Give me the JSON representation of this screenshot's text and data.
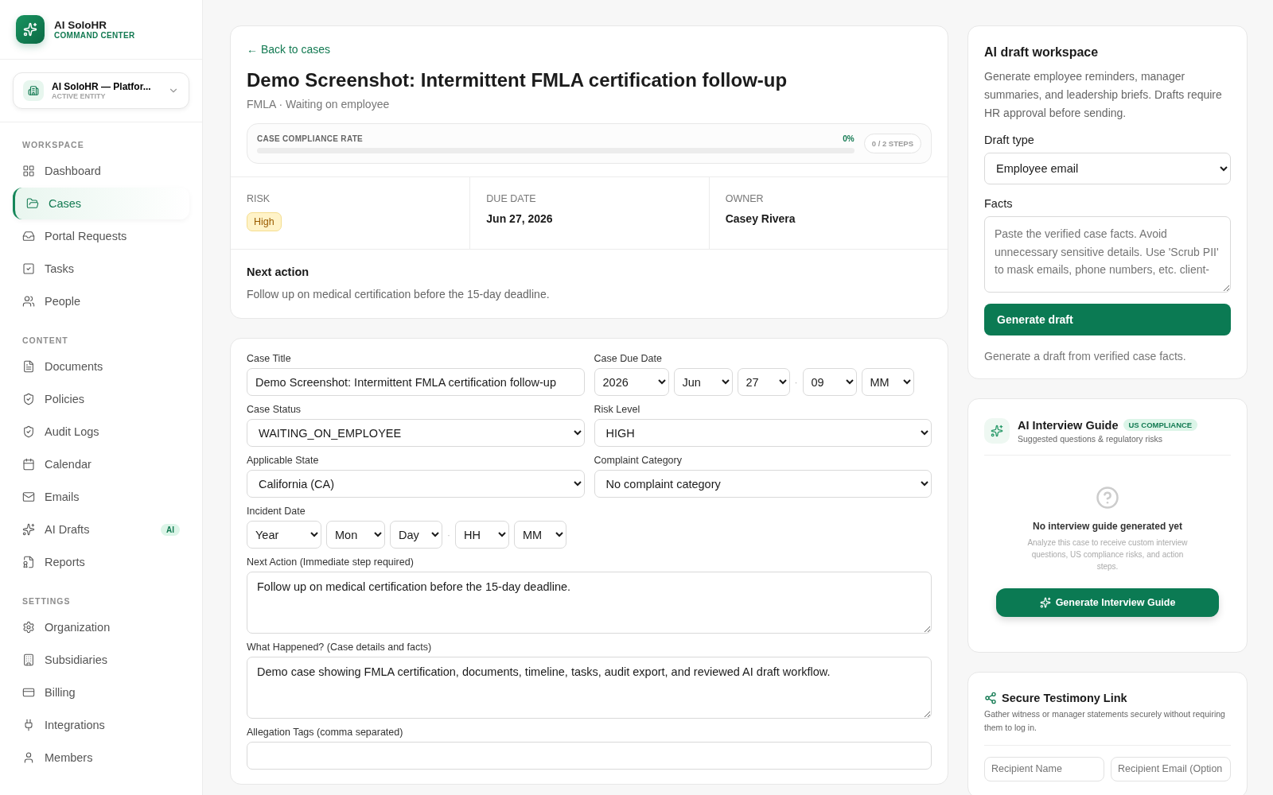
{
  "sidebar": {
    "brand": {
      "name": "AI SoloHR",
      "subtitle": "COMMAND CENTER"
    },
    "entity": {
      "name": "AI SoloHR — Platfor...",
      "caption": "ACTIVE ENTITY"
    },
    "sections": [
      {
        "heading": "WORKSPACE",
        "items": [
          {
            "label": "Dashboard",
            "selected": false
          },
          {
            "label": "Cases",
            "selected": true
          },
          {
            "label": "Portal Requests",
            "selected": false
          },
          {
            "label": "Tasks",
            "selected": false
          },
          {
            "label": "People",
            "selected": false
          }
        ]
      },
      {
        "heading": "CONTENT",
        "items": [
          {
            "label": "Documents",
            "selected": false
          },
          {
            "label": "Policies",
            "selected": false
          },
          {
            "label": "Audit Logs",
            "selected": false
          },
          {
            "label": "Calendar",
            "selected": false
          },
          {
            "label": "Emails",
            "selected": false
          },
          {
            "label": "AI Drafts",
            "selected": false,
            "badge": "AI"
          },
          {
            "label": "Reports",
            "selected": false
          }
        ]
      },
      {
        "heading": "SETTINGS",
        "items": [
          {
            "label": "Organization",
            "selected": false
          },
          {
            "label": "Subsidiaries",
            "selected": false
          },
          {
            "label": "Billing",
            "selected": false
          },
          {
            "label": "Integrations",
            "selected": false
          },
          {
            "label": "Members",
            "selected": false
          }
        ]
      }
    ]
  },
  "case": {
    "back_link": "← Back to cases",
    "title": "Demo Screenshot: Intermittent FMLA certification follow-up",
    "subtitle": "FMLA · Waiting on employee",
    "compliance": {
      "label": "CASE COMPLIANCE RATE",
      "percent": "0%",
      "level": 0,
      "steps": "0 / 2 STEPS"
    },
    "stats": [
      {
        "label": "RISK",
        "value": "High",
        "kind": "badge"
      },
      {
        "label": "DUE DATE",
        "value": "Jun 27, 2026",
        "kind": "text"
      },
      {
        "label": "OWNER",
        "value": "Casey Rivera",
        "kind": "text"
      }
    ],
    "next_action": {
      "heading": "Next action",
      "text": "Follow up on medical certification before the 15-day deadline."
    }
  },
  "form": {
    "rows": [
      {
        "fields": [
          {
            "kind": "text",
            "label": "Case Title",
            "value": "Demo Screenshot: Intermittent FMLA certification follow-up"
          },
          {
            "kind": "datetime",
            "label": "Case Due Date",
            "date_parts": [
              "2026",
              "Jun",
              "27"
            ],
            "separator": "·",
            "time_parts": [
              "09",
              "MM"
            ]
          }
        ]
      },
      {
        "fields": [
          {
            "kind": "select",
            "label": "Case Status",
            "value": "WAITING_ON_EMPLOYEE"
          },
          {
            "kind": "select",
            "label": "Risk Level",
            "value": "HIGH"
          }
        ]
      },
      {
        "fields": [
          {
            "kind": "select",
            "label": "Applicable State",
            "value": "California (CA)"
          },
          {
            "kind": "select",
            "label": "Complaint Category",
            "value": "No complaint category"
          }
        ]
      },
      {
        "fields": [
          {
            "kind": "datetime",
            "label": "Incident Date",
            "date_parts": [
              "Year",
              "Mon",
              "Day"
            ],
            "separator": "·",
            "time_parts": [
              "HH",
              "MM"
            ]
          }
        ]
      },
      {
        "fields": [
          {
            "kind": "textarea",
            "label": "Next Action (Immediate step required)",
            "value": "Follow up on medical certification before the 15-day deadline."
          }
        ]
      },
      {
        "fields": [
          {
            "kind": "textarea",
            "label": "What Happened? (Case details and facts)",
            "value": "Demo case showing FMLA certification, documents, timeline, tasks, audit export, and reviewed AI draft workflow."
          }
        ]
      },
      {
        "fields": [
          {
            "kind": "text",
            "label": "Allegation Tags (comma separated)"
          }
        ]
      }
    ]
  },
  "draft_workspace": {
    "title": "AI draft workspace",
    "description": "Generate employee reminders, manager summaries, and leadership briefs. Drafts require HR approval before sending.",
    "draft_type_label": "Draft type",
    "draft_type_value": "Employee email",
    "facts_label": "Facts",
    "facts_placeholder": "Paste the verified case facts. Avoid unnecessary sensitive details. Use 'Scrub PII' to mask emails, phone numbers, etc. client-",
    "button": "Generate draft",
    "hint": "Generate a draft from verified case facts."
  },
  "interview_guide": {
    "title": "AI Interview Guide",
    "badge": "US COMPLIANCE",
    "subtitle": "Suggested questions & regulatory risks",
    "empty_title": "No interview guide generated yet",
    "empty_text": "Analyze this case to receive custom interview questions, US compliance risks, and action steps.",
    "button": "Generate Interview Guide"
  },
  "testimony": {
    "title": "Secure Testimony Link",
    "description": "Gather witness or manager statements securely without requiring them to log in.",
    "name_placeholder": "Recipient Name",
    "email_placeholder": "Recipient Email (Option"
  }
}
